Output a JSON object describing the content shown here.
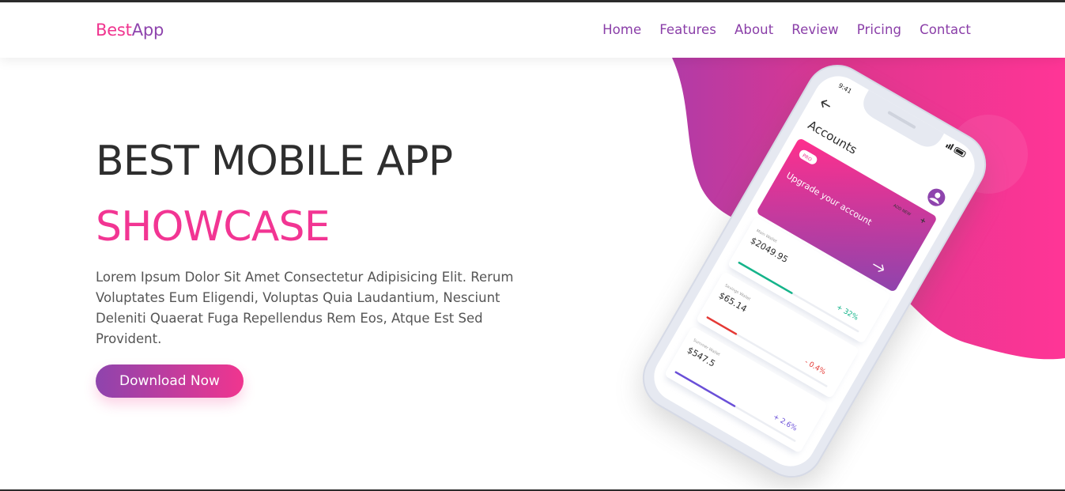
{
  "header": {
    "logo_part1": "Best",
    "logo_part2": "App",
    "nav": [
      "Home",
      "Features",
      "About",
      "Review",
      "Pricing",
      "Contact"
    ]
  },
  "hero": {
    "title_line1": "BEST MOBILE APP",
    "title_line2": "SHOWCASE",
    "description": "Lorem Ipsum Dolor Sit Amet Consectetur Adipisicing Elit. Rerum Voluptates Eum Eligendi, Voluptas Quia Laudantium, Nesciunt Deleniti Quaerat Fuga Repellendus Rem Eos, Atque Est Sed Provident.",
    "cta_label": "Download Now"
  },
  "phone": {
    "time": "9:41",
    "screen_title": "Accounts",
    "promo_badge": "PRO",
    "promo_text": "Upgrade your account",
    "add_new": "ADD NEW",
    "wallets": [
      {
        "name": "Main Wallet",
        "amount": "$2049.95",
        "change": "+ 32%",
        "color": "#15b48a",
        "progress": 0.45
      },
      {
        "name": "Savings Wallet",
        "amount": "$65.14",
        "change": "- 0.4%",
        "color": "#e53935",
        "progress": 0.25
      },
      {
        "name": "Summer Wallet",
        "amount": "$547.5",
        "change": "+ 2.6%",
        "color": "#6a4fd8",
        "progress": 0.5
      }
    ]
  },
  "colors": {
    "brand_pink": "#f0358f",
    "brand_purple": "#8e44ad",
    "heading_dark": "#2e2e2e",
    "nav_purple": "#8a3ea8"
  }
}
